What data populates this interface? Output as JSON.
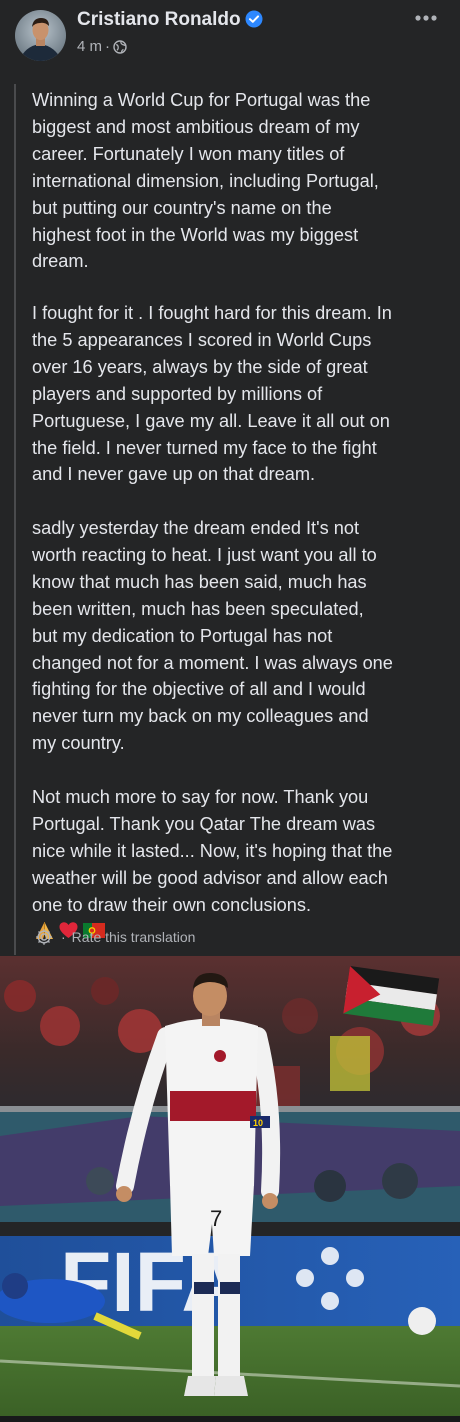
{
  "post": {
    "author": "Cristiano Ronaldo",
    "verified": true,
    "time": "4 m",
    "separator": "·",
    "audience_icon": "globe-icon",
    "paragraphs": [
      "Winning a World Cup for Portugal was the\nbiggest and most ambitious dream of my\ncareer. Fortunately I won many titles of\ninternational dimension, including Portugal,\nbut putting our country's name on the\nhighest foot in the World was my biggest\ndream.",
      "I fought for it . I fought hard for this dream. In\nthe 5 appearances I scored in World Cups\nover 16 years, always by the side of great\nplayers and supported by millions of\nPortuguese, I gave my all. Leave it all out on\nthe field. I never turned my face to the fight\nand I never gave up on that dream.",
      "sadly yesterday the dream ended It's not\nworth reacting to heat. I just want you all to\nknow that much has been said, much has\nbeen written, much has been speculated,\nbut my dedication to Portugal has not\nchanged not for a moment. I was always one\nfighting for the objective of all and I would\nnever turn my back on my colleagues and\nmy country.",
      "Not much more to say for now. Thank you\nPortugal. Thank you Qatar The dream was\nnice while it lasted... Now, it's hoping that the\nweather will be good advisor and allow each\none to draw their own conclusions."
    ],
    "closing_emojis": [
      "praying-hands",
      "red-heart",
      "portugal-flag"
    ],
    "rate_separator": "·",
    "rate_translation": "Rate this translation"
  },
  "photo": {
    "banner_text": "FIFA",
    "shirt_number": "7",
    "captain_band": "10"
  },
  "colors": {
    "background": "#242526",
    "text_primary": "#e4e6eb",
    "text_secondary": "#b0b3b8",
    "verified_blue": "#2d88ff"
  }
}
